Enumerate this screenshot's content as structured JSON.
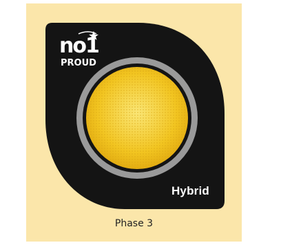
{
  "badge": {
    "brand_number": "no1",
    "brand_text": "PROUD",
    "mode_label": "Hybrid",
    "light_color": "#f2c521",
    "light_ring_color": "#9a9a9a",
    "badge_color": "#141414"
  },
  "caption": "Phase 3"
}
